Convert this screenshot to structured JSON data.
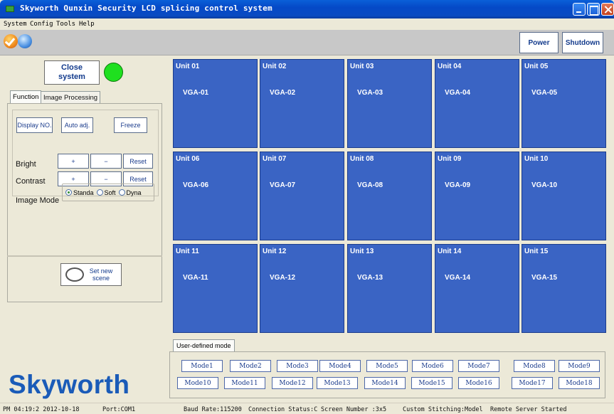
{
  "window": {
    "title": "Skyworth Qunxin Security LCD splicing control system"
  },
  "menu": [
    "System",
    "Config",
    "Tools",
    "Help"
  ],
  "toolbar": {
    "icons": [
      "check-icon",
      "globe-icon"
    ],
    "power_label": "Power",
    "shutdown_label": "Shutdown"
  },
  "left": {
    "close_label_1": "Close",
    "close_label_2": "system",
    "tabs": [
      "Function",
      "Image Processing"
    ],
    "display_no": "Display NO.",
    "auto_adj": "Auto adj.",
    "freeze": "Freeze",
    "bright_label": "Bright",
    "contrast_label": "Contrast",
    "plus": "+",
    "minus": "−",
    "reset": "Reset",
    "image_mode_label": "Image Mode",
    "image_modes": [
      "Standa",
      "Soft",
      "Dyna"
    ],
    "scene_label_1": "Set new",
    "scene_label_2": "scene",
    "logo": "Skyworth"
  },
  "units": [
    {
      "name": "Unit 01",
      "source": "VGA-01"
    },
    {
      "name": "Unit 02",
      "source": "VGA-02"
    },
    {
      "name": "Unit 03",
      "source": "VGA-03"
    },
    {
      "name": "Unit 04",
      "source": "VGA-04"
    },
    {
      "name": "Unit 05",
      "source": "VGA-05"
    },
    {
      "name": "Unit 06",
      "source": "VGA-06"
    },
    {
      "name": "Unit 07",
      "source": "VGA-07"
    },
    {
      "name": "Unit 08",
      "source": "VGA-08"
    },
    {
      "name": "Unit 09",
      "source": "VGA-09"
    },
    {
      "name": "Unit 10",
      "source": "VGA-10"
    },
    {
      "name": "Unit 11",
      "source": "VGA-11"
    },
    {
      "name": "Unit 12",
      "source": "VGA-12"
    },
    {
      "name": "Unit 13",
      "source": "VGA-13"
    },
    {
      "name": "Unit 14",
      "source": "VGA-14"
    },
    {
      "name": "Unit 15",
      "source": "VGA-15"
    }
  ],
  "modes": {
    "tab": "User-defined mode",
    "items": [
      "Mode1",
      "Mode2",
      "Mode3",
      "Mode4",
      "Mode5",
      "Mode6",
      "Mode7",
      "Mode8",
      "Mode9",
      "Mode10",
      "Mode11",
      "Mode12",
      "Mode13",
      "Mode14",
      "Mode15",
      "Mode16",
      "Mode17",
      "Mode18"
    ]
  },
  "status": {
    "time": "PM 04:19:2 2012-10-18",
    "port": "Port:COM1",
    "baud": "Baud Rate:115200",
    "connection": "Connection Status:C",
    "screen": "Screen Number :3x5",
    "stitching": "Custom Stitching:Model",
    "remote": "Remote Server Started"
  },
  "colors": {
    "unit_fill": "#3a64c4",
    "status_led": "#1fe01f",
    "logo": "#1a5bb8"
  }
}
